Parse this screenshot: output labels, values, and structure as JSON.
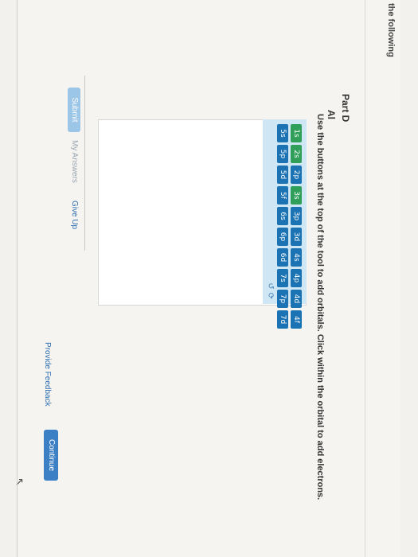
{
  "header": {
    "note": "the following"
  },
  "part": {
    "title": "Part D",
    "subtitle": "Al",
    "instructions": "Use the buttons at the top of the tool to add orbitals. Click within the orbital to add electrons."
  },
  "orbital_tool": {
    "row1": [
      "1s",
      "2s",
      "2p",
      "3s",
      "3p",
      "3d",
      "4s",
      "4p",
      "4d",
      "4f"
    ],
    "row2": [
      "5s",
      "5p",
      "5d",
      "5f",
      "6s",
      "6p",
      "6d",
      "7s",
      "7p",
      "7d"
    ],
    "highlighted": [
      "1s",
      "2s",
      "3s"
    ],
    "tools": {
      "undo_icon": "undo-icon",
      "reset_icon": "reset-icon"
    }
  },
  "actions": {
    "submit": "Submit",
    "my_answers": "My Answers",
    "give_up": "Give Up"
  },
  "footer": {
    "feedback": "Provide Feedback",
    "continue": "Continue"
  },
  "colors": {
    "button_blue": "#1c73b4",
    "button_green": "#2f9f5a",
    "toolbar_bg": "#cfe6f4",
    "link": "#2f6fb0"
  }
}
